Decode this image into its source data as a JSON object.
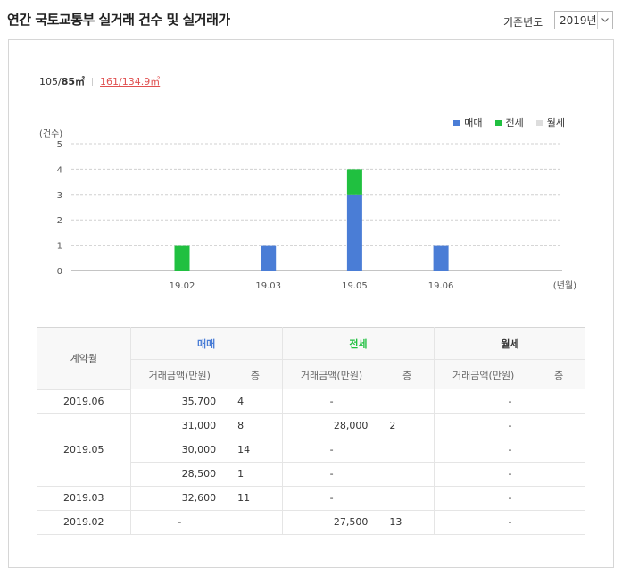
{
  "header": {
    "title": "연간 국토교통부 실거래 건수 및 실거래가",
    "year_label": "기준년도",
    "year_value": "2019년"
  },
  "area_tabs": {
    "first_num": "105/",
    "first_bold": "85㎡",
    "second": "161/134.9㎡"
  },
  "legend": [
    {
      "label": "매매",
      "color": "#4a7dd6"
    },
    {
      "label": "전세",
      "color": "#20c040"
    },
    {
      "label": "월세",
      "color": "#dddddd"
    }
  ],
  "chart_data": {
    "type": "bar",
    "stacked": true,
    "ylabel": "(건수)",
    "xlabel": "(년월)",
    "ylim": [
      0,
      5
    ],
    "yticks": [
      0,
      1,
      2,
      3,
      4,
      5
    ],
    "categories": [
      "19.02",
      "19.03",
      "19.05",
      "19.06"
    ],
    "series": [
      {
        "name": "매매",
        "color": "#4a7dd6",
        "values": [
          0,
          1,
          3,
          1
        ]
      },
      {
        "name": "전세",
        "color": "#20c040",
        "values": [
          1,
          0,
          1,
          0
        ]
      },
      {
        "name": "월세",
        "color": "#dddddd",
        "values": [
          0,
          0,
          0,
          0
        ]
      }
    ]
  },
  "table": {
    "col_month": "계약월",
    "groups": [
      {
        "label": "매매",
        "sub": [
          "거래금액(만원)",
          "층"
        ]
      },
      {
        "label": "전세",
        "sub": [
          "거래금액(만원)",
          "층"
        ]
      },
      {
        "label": "월세",
        "sub": [
          "거래금액(만원)",
          "층"
        ]
      }
    ],
    "rows": [
      {
        "month": "2019.06",
        "span": 1,
        "sale": "35,700",
        "sale_floor": "4",
        "jeonse": "-",
        "jeonse_floor": "",
        "monthly": "-"
      },
      {
        "month": "2019.05",
        "span": 3,
        "sale": "31,000",
        "sale_floor": "8",
        "jeonse": "28,000",
        "jeonse_floor": "2",
        "monthly": "-"
      },
      {
        "month": "",
        "span": 0,
        "sale": "30,000",
        "sale_floor": "14",
        "jeonse": "-",
        "jeonse_floor": "",
        "monthly": "-"
      },
      {
        "month": "",
        "span": 0,
        "sale": "28,500",
        "sale_floor": "1",
        "jeonse": "-",
        "jeonse_floor": "",
        "monthly": "-"
      },
      {
        "month": "2019.03",
        "span": 1,
        "sale": "32,600",
        "sale_floor": "11",
        "jeonse": "-",
        "jeonse_floor": "",
        "monthly": "-"
      },
      {
        "month": "2019.02",
        "span": 1,
        "sale": "-",
        "sale_floor": "",
        "jeonse": "27,500",
        "jeonse_floor": "13",
        "monthly": "-"
      }
    ]
  }
}
